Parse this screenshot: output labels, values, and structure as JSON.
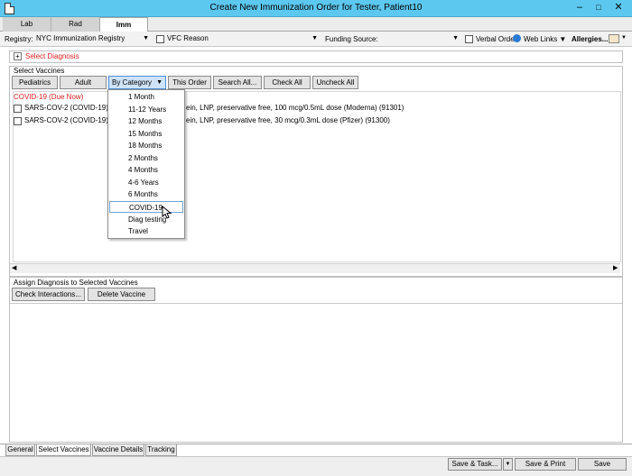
{
  "window": {
    "title": "Create New Immunization Order for Tester, Patient10"
  },
  "top_tabs": [
    "Lab",
    "Rad",
    "Imm"
  ],
  "registry": {
    "label": "Registry:",
    "value": "NYC Immunization Registry",
    "vfc_label": "VFC Reason",
    "funding_label": "Funding Source:",
    "verbal_order_label": "Verbal Order",
    "web_links_label": "Web Links",
    "allergies_label": "Allergies..."
  },
  "select_diagnosis": {
    "label": "Select Diagnosis"
  },
  "select_vaccines": {
    "title": "Select Vaccines",
    "buttons": [
      "Pediatrics",
      "Adult",
      "By Category",
      "This Order",
      "Search All...",
      "Check All",
      "Uncheck All"
    ],
    "group_header": "COVID-19 (Due Now)",
    "vaccines": [
      {
        "prefix": "SARS-COV-2 (COVID-19) va",
        "suffix": "ein, LNP, preservative free, 100 mcg/0.5mL dose (Moderna) (91301)"
      },
      {
        "prefix": "SARS-COV-2 (COVID-19) va",
        "suffix": "ein, LNP, preservative free, 30 mcg/0.3mL dose (Pfizer) (91300)"
      }
    ]
  },
  "category_menu": {
    "items": [
      "1 Month",
      "11-12 Years",
      "12 Months",
      "15 Months",
      "18 Months",
      "2 Months",
      "4 Months",
      "4-6 Years",
      "6 Months",
      "COVID-19",
      "Diag testing",
      "Travel"
    ],
    "highlighted": "COVID-19"
  },
  "assign_diagnosis": {
    "title": "Assign Diagnosis to Selected Vaccines",
    "buttons": [
      "Check Interactions...",
      "Delete Vaccine"
    ]
  },
  "bottom_tabs": [
    "General",
    "Select Vaccines",
    "Vaccine Details",
    "Tracking"
  ],
  "footer_buttons": [
    "Save & Task...",
    "Save & Print",
    "Save"
  ],
  "colors": {
    "titlebar": "#5cc8ef",
    "alert_red": "#e02020",
    "highlight_border": "#6ea3d8"
  }
}
